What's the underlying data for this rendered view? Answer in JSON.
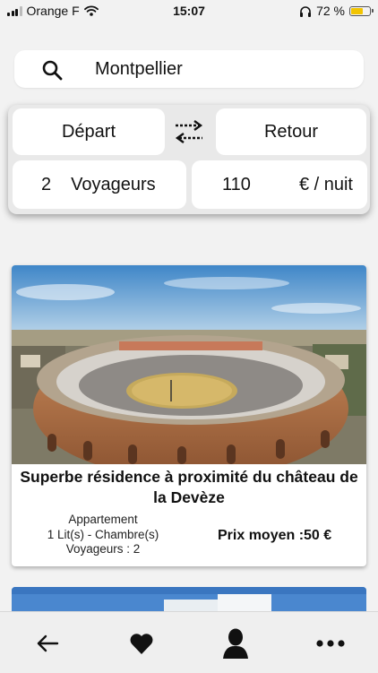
{
  "status_bar": {
    "carrier": "Orange F",
    "time": "15:07",
    "battery_percent": "72 %",
    "battery_level": 0.72
  },
  "search": {
    "value": "Montpellier"
  },
  "filters": {
    "depart_label": "Départ",
    "retour_label": "Retour",
    "travelers_count": "2",
    "travelers_label": "Voyageurs",
    "price_value": "110",
    "price_unit": "€ / nuit"
  },
  "listings": [
    {
      "title": "Superbe résidence à proximité du château de la Devèze",
      "type": "Appartement",
      "rooms": "1 Lit(s) -  Chambre(s)",
      "guests": "Voyageurs : 2",
      "price": "Prix moyen :50 €"
    }
  ],
  "nav": {
    "items": [
      "back-arrow-icon",
      "heart-icon",
      "user-icon",
      "more-icon"
    ]
  },
  "colors": {
    "background": "#f2f2f2",
    "card": "#ffffff",
    "filter_panel": "#e9e9e9",
    "battery": "#f2c400"
  }
}
